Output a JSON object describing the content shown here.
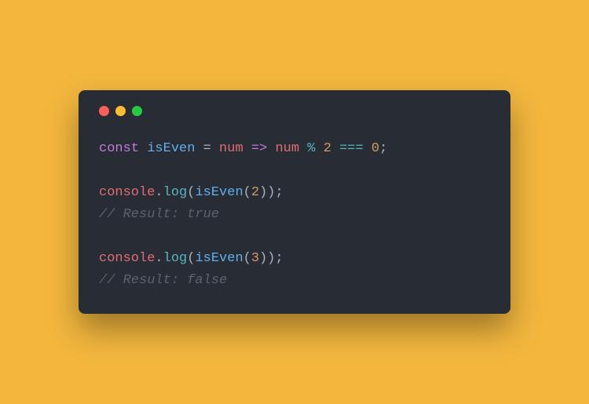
{
  "code": {
    "l1": {
      "kw": "const",
      "name": "isEven",
      "eq": " = ",
      "param": "num",
      "arrow": " => ",
      "param2": "num",
      "mod": " % ",
      "two": "2",
      "seq": " === ",
      "zero": "0",
      "semi": ";"
    },
    "l2": {
      "obj": "console",
      "dot": ".",
      "method": "log",
      "open": "(",
      "fn": "isEven",
      "open2": "(",
      "arg": "2",
      "close2": ")",
      "close": ")",
      "semi": ";"
    },
    "l3": {
      "comment": "// Result: true"
    },
    "l4": {
      "obj": "console",
      "dot": ".",
      "method": "log",
      "open": "(",
      "fn": "isEven",
      "open2": "(",
      "arg": "3",
      "close2": ")",
      "close": ")",
      "semi": ";"
    },
    "l5": {
      "comment": "// Result: false"
    }
  }
}
